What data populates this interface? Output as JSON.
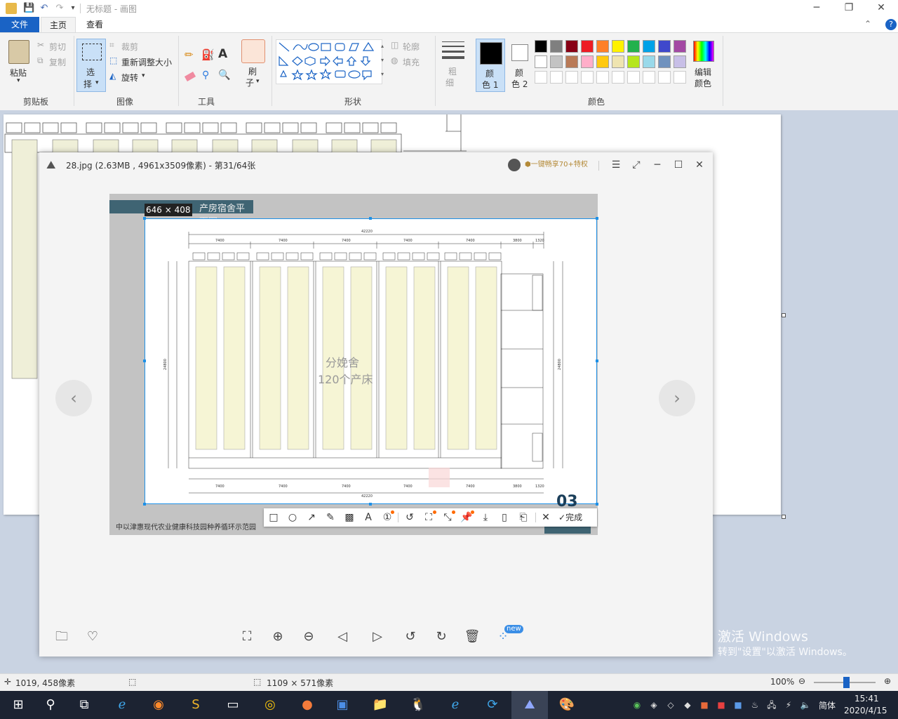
{
  "title_bar": {
    "title": "无标题 - 画图",
    "minimize": "─",
    "maximize": "❐",
    "close": "✕"
  },
  "menu": {
    "file": "文件",
    "home": "主页",
    "view": "查看",
    "help": "?"
  },
  "ribbon": {
    "clipboard": {
      "paste": "粘贴",
      "cut": "剪切",
      "copy": "复制",
      "label": "剪贴板"
    },
    "image": {
      "select_1": "选",
      "select_2": "择",
      "crop": "裁剪",
      "resize": "重新调整大小",
      "rotate": "旋转",
      "label": "图像"
    },
    "tools": {
      "label": "工具"
    },
    "brush": {
      "line1": "刷",
      "line2": "子"
    },
    "shapes": {
      "outline": "轮廓",
      "fill": "填充",
      "label": "形状"
    },
    "size": {
      "line1": "粗",
      "line2": "细"
    },
    "color1": {
      "line1": "颜",
      "line2": "色 1"
    },
    "color2": {
      "line1": "颜",
      "line2": "色 2"
    },
    "edit_colors": {
      "line1": "编辑",
      "line2": "颜色"
    },
    "colors_label": "颜色",
    "palette_row1": [
      "#000000",
      "#7f7f7f",
      "#880015",
      "#ed1c24",
      "#ff7f27",
      "#fff200",
      "#22b14c",
      "#00a2e8",
      "#3f48cc",
      "#a349a4"
    ],
    "palette_row2": [
      "#ffffff",
      "#c3c3c3",
      "#b97a57",
      "#ffaec9",
      "#ffc90e",
      "#efe4b0",
      "#b5e61d",
      "#99d9ea",
      "#7092be",
      "#c8bfe7"
    ]
  },
  "viewer": {
    "file_info": "28.jpg (2.63MB , 4961x3509像素) - 第31/64张",
    "vip_text": "一键畅享70+特权",
    "selection_size": "646 × 408",
    "image_header": "产房宿舍平面图",
    "image_footer": "中以津惠现代农业健康科技园种养循环示范园",
    "page_number": "03",
    "plan_center_1": "分娩舍",
    "plan_center_2": "120个产床",
    "dim_total": "42220",
    "dim_bay": "7400",
    "dim_end1": "3800",
    "dim_end2": "1320",
    "dim_height": "24800",
    "done": "完成",
    "new_badge": "new"
  },
  "watermark": {
    "line1": "激活 Windows",
    "line2": "转到\"设置\"以激活 Windows。"
  },
  "status": {
    "cursor": "1019, 458像素",
    "size": "1109 × 571像素",
    "zoom": "100%"
  },
  "taskbar": {
    "ime": "简体",
    "time": "15:41",
    "date": "2020/4/15"
  }
}
